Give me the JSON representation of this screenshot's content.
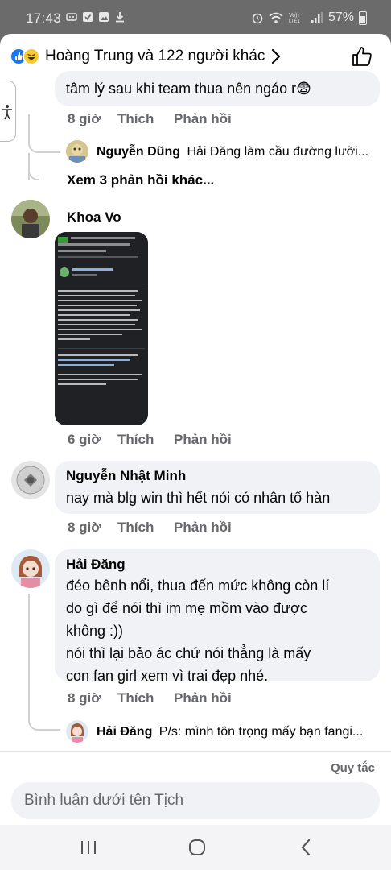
{
  "status_bar": {
    "time": "17:43",
    "battery": "57%",
    "network": "Vo)) LTE1"
  },
  "header": {
    "title": "Hoàng Trung và 122 người khác"
  },
  "comments": [
    {
      "text": "tâm lý sau khi team thua nên ngáo r😨",
      "time": "8 giờ",
      "like": "Thích",
      "reply": "Phản hồi",
      "reply_preview": {
        "name": "Nguyễn Dũng",
        "text": "Hải Đăng làm cầu đường lưỡi..."
      },
      "more_replies": "Xem 3 phản hồi khác..."
    },
    {
      "name": "Khoa Vo",
      "time": "6 giờ",
      "like": "Thích",
      "reply": "Phản hồi"
    },
    {
      "name": "Nguyễn Nhật Minh",
      "text": "nay mà blg win thì hết nói có nhân tố hàn",
      "time": "8 giờ",
      "like": "Thích",
      "reply": "Phản hồi"
    },
    {
      "name": "Hải Đăng",
      "lines": [
        "đéo bênh nổi, thua đến mức không còn lí",
        "do gì để nói thì im mẹ mồm vào được",
        "không :))",
        "nói thì lại bảo ác chứ nói thẳng là mấy",
        "con fan girl xem vì trai đẹp nhé."
      ],
      "time": "8 giờ",
      "like": "Thích",
      "reply": "Phản hồi",
      "reply_preview": {
        "name": "Hải Đăng",
        "text": "P/s: mình tôn trọng mấy bạn fangi..."
      }
    }
  ],
  "footer": {
    "rules": "Quy tắc",
    "input_placeholder": "Bình luận dưới tên Tịch"
  },
  "colors": {
    "accent": "#1877f2",
    "bubble": "#f0f2f5",
    "muted": "#65676b"
  },
  "icons": [
    "like-reaction-icon",
    "haha-reaction-icon",
    "chevron-right-icon",
    "thumbs-up-icon",
    "accessibility-icon",
    "recents-icon",
    "home-icon",
    "back-icon"
  ]
}
